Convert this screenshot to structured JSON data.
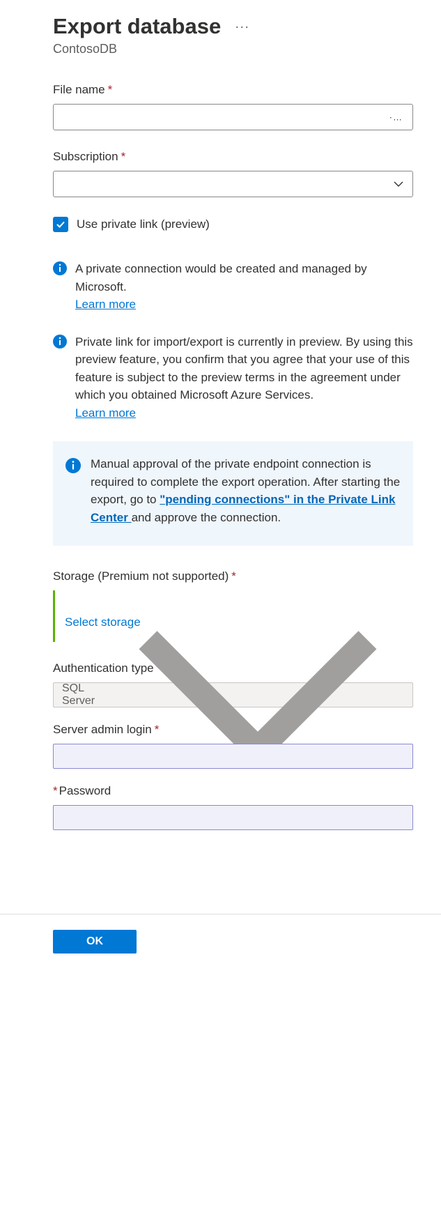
{
  "header": {
    "title": "Export database",
    "resource": "ContosoDB"
  },
  "form": {
    "filename": {
      "label": "File name",
      "value": ""
    },
    "subscription": {
      "label": "Subscription",
      "value": ""
    },
    "private_link": {
      "label": "Use private link (preview)",
      "checked": true
    },
    "info1": {
      "text": "A private connection would be created and managed by Microsoft.",
      "learn_more": "Learn more"
    },
    "info2": {
      "text": "Private link for import/export is currently in preview. By using this preview feature, you confirm that you agree that your use of this feature is subject to the preview terms in the agreement under which you obtained Microsoft Azure Services.",
      "learn_more": "Learn more"
    },
    "callout": {
      "before": "Manual approval of the private endpoint connection is required to complete the export operation. After starting the export, go to ",
      "link": "\"pending connections\" in the Private Link Center ",
      "after": "and approve the connection."
    },
    "storage": {
      "label": "Storage (Premium not supported)",
      "select_label": "Select storage"
    },
    "auth": {
      "label": "Authentication type",
      "value": "SQL Server"
    },
    "login": {
      "label": "Server admin login",
      "value": ""
    },
    "password": {
      "label": "Password",
      "value": ""
    }
  },
  "footer": {
    "ok": "OK"
  }
}
